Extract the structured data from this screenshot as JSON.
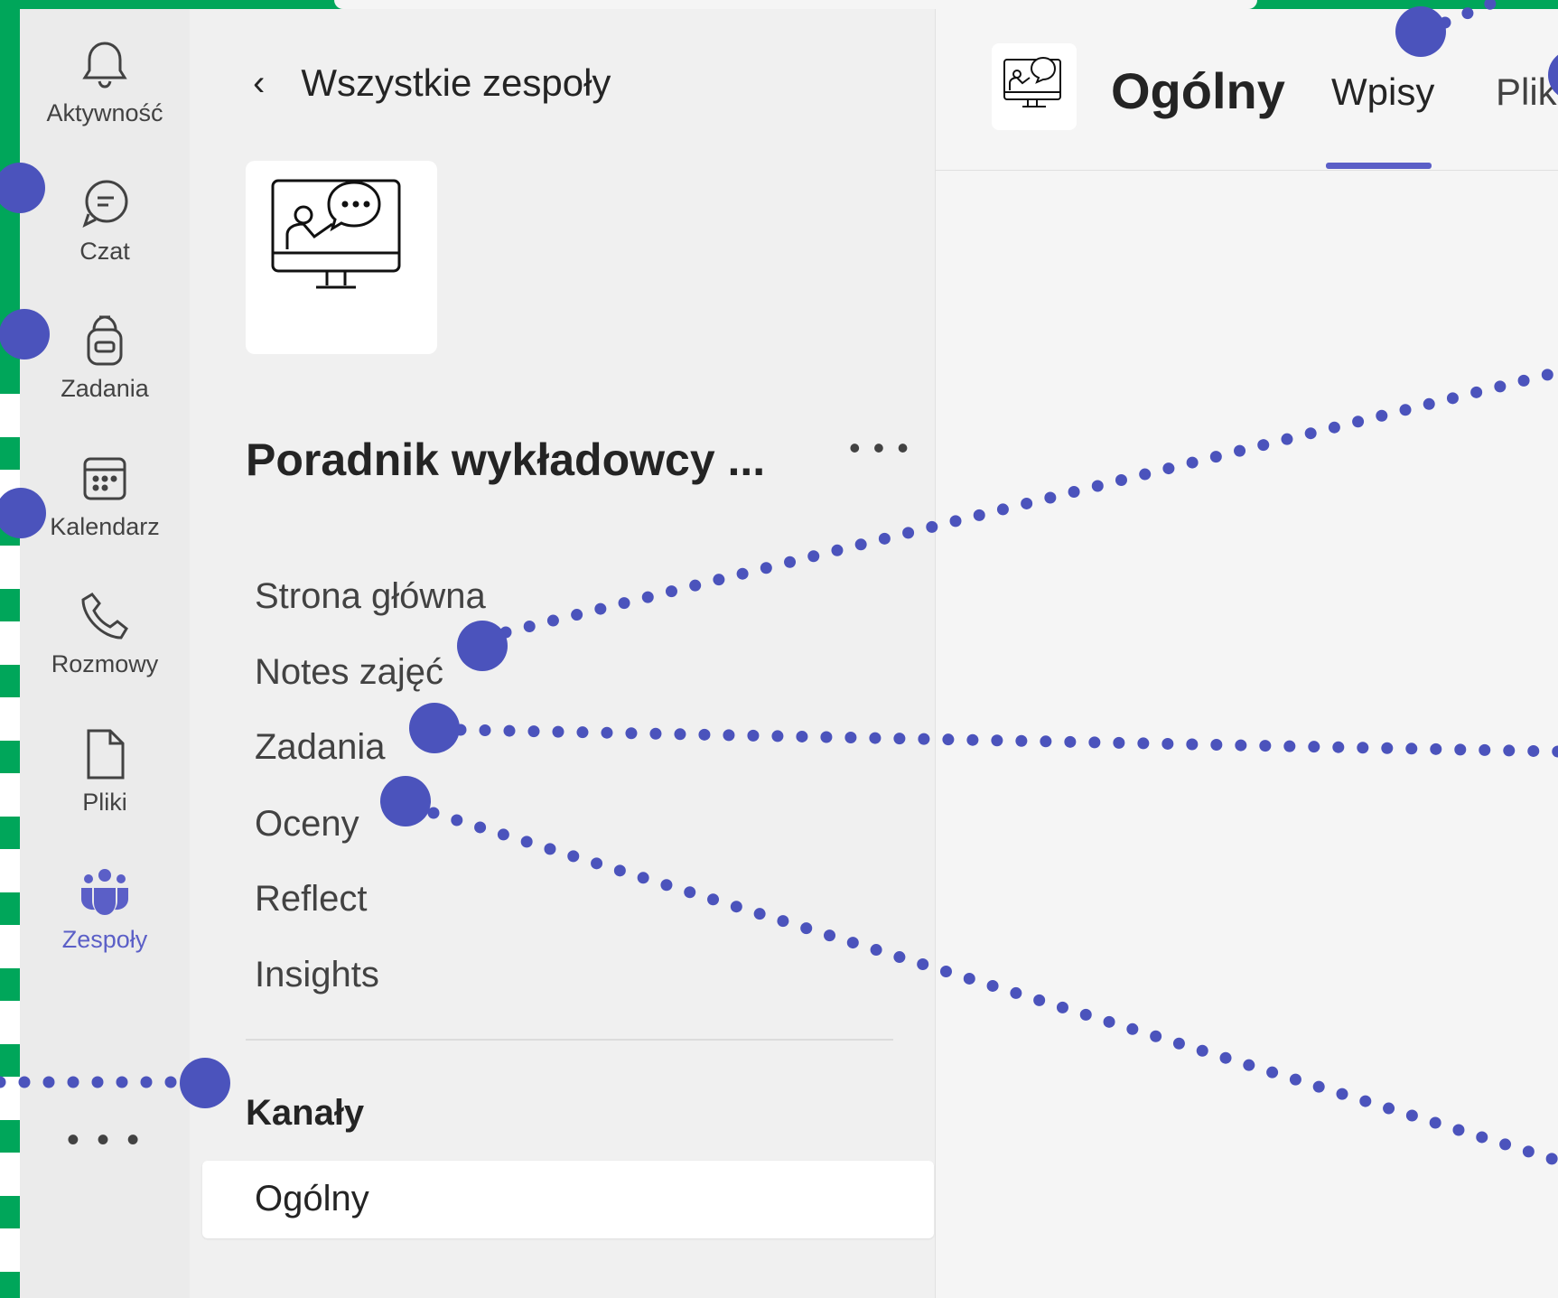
{
  "rail": {
    "items": [
      {
        "label": "Aktywność",
        "icon": "bell-icon"
      },
      {
        "label": "Czat",
        "icon": "chat-icon"
      },
      {
        "label": "Zadania",
        "icon": "backpack-icon"
      },
      {
        "label": "Kalendarz",
        "icon": "calendar-icon"
      },
      {
        "label": "Rozmowy",
        "icon": "phone-icon"
      },
      {
        "label": "Pliki",
        "icon": "file-icon"
      },
      {
        "label": "Zespoły",
        "icon": "teams-icon"
      }
    ],
    "more": "• • •"
  },
  "team": {
    "back_label": "Wszystkie zespoły",
    "name": "Poradnik wykładowcy ...",
    "more": "• • •",
    "links": [
      "Strona główna",
      "Notes zajęć",
      "Zadania",
      "Oceny",
      "Reflect",
      "Insights"
    ],
    "channels_heading": "Kanały",
    "channel": "Ogólny"
  },
  "main": {
    "title": "Ogólny",
    "tabs": [
      "Wpisy",
      "Pliki"
    ]
  },
  "colors": {
    "accent": "#5b5fc7",
    "annotation": "#4b53bc",
    "frame": "#00a65a"
  }
}
